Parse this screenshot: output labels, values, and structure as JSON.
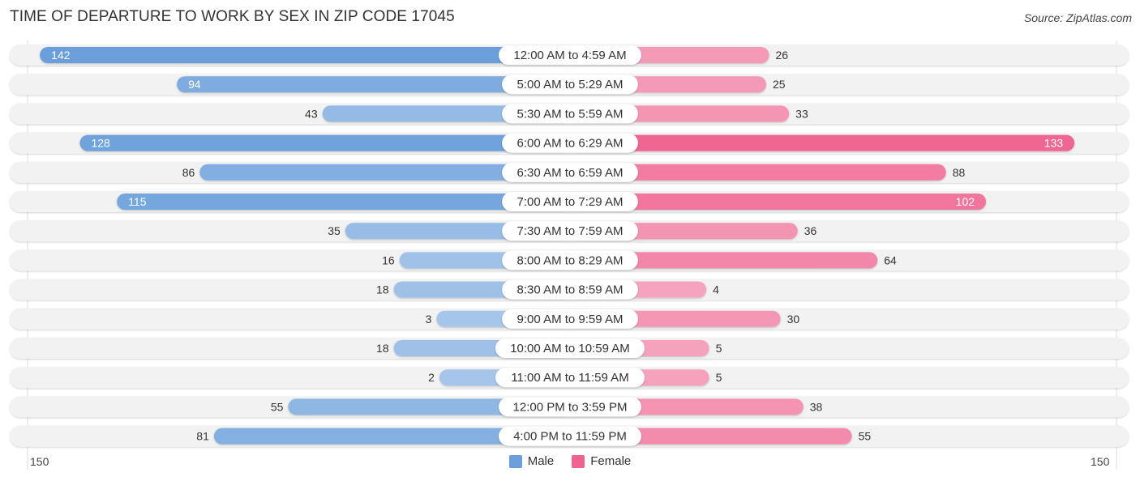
{
  "header": {
    "title": "TIME OF DEPARTURE TO WORK BY SEX IN ZIP CODE 17045",
    "source": "Source: ZipAtlas.com"
  },
  "colors": {
    "male": "#6a9fdb",
    "male_light": "#a7c6ea",
    "female": "#f06290",
    "female_light": "#f5a5bf",
    "track": "#f2f2f2"
  },
  "chart_data": {
    "type": "bar",
    "orientation": "horizontal-diverging",
    "title": "TIME OF DEPARTURE TO WORK BY SEX IN ZIP CODE 17045",
    "categories": [
      "12:00 AM to 4:59 AM",
      "5:00 AM to 5:29 AM",
      "5:30 AM to 5:59 AM",
      "6:00 AM to 6:29 AM",
      "6:30 AM to 6:59 AM",
      "7:00 AM to 7:29 AM",
      "7:30 AM to 7:59 AM",
      "8:00 AM to 8:29 AM",
      "8:30 AM to 8:59 AM",
      "9:00 AM to 9:59 AM",
      "10:00 AM to 10:59 AM",
      "11:00 AM to 11:59 AM",
      "12:00 PM to 3:59 PM",
      "4:00 PM to 11:59 PM"
    ],
    "series": [
      {
        "name": "Male",
        "values": [
          142,
          94,
          43,
          128,
          86,
          115,
          35,
          16,
          18,
          3,
          18,
          2,
          55,
          81
        ]
      },
      {
        "name": "Female",
        "values": [
          26,
          25,
          33,
          133,
          88,
          102,
          36,
          64,
          4,
          30,
          5,
          5,
          38,
          55
        ]
      }
    ],
    "axis": {
      "left_label": "150",
      "right_label": "150",
      "max": 150
    },
    "legend": {
      "position": "bottom-center",
      "items": [
        "Male",
        "Female"
      ]
    },
    "grid": false
  }
}
